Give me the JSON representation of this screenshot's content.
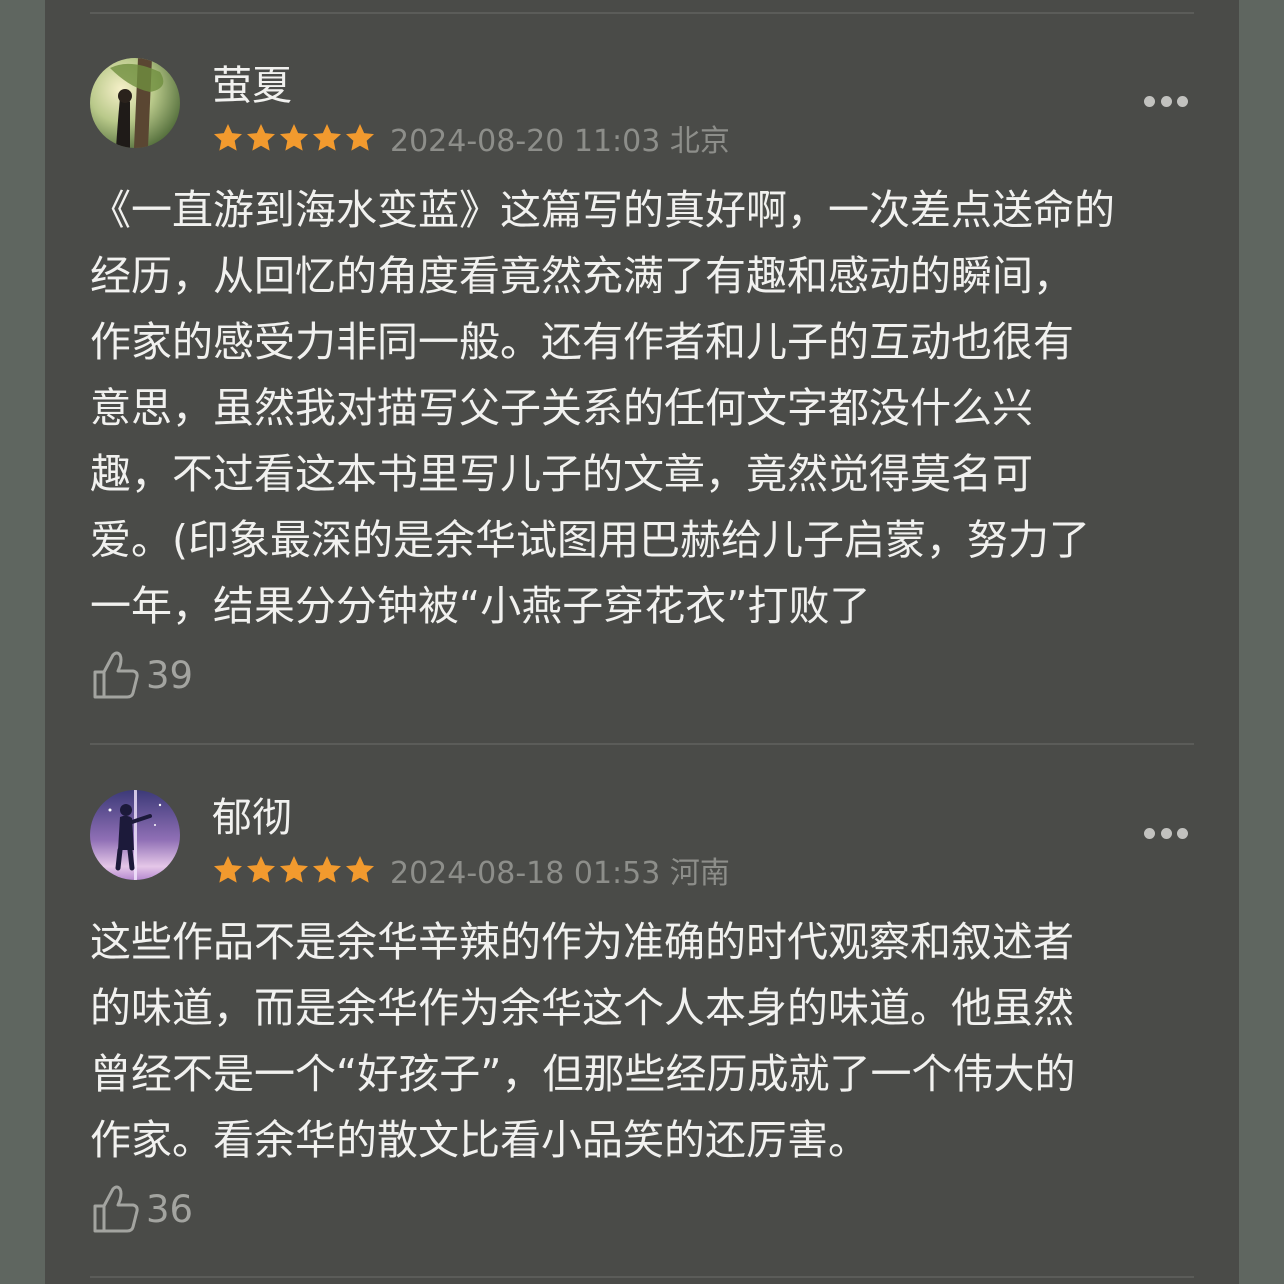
{
  "colors": {
    "background": "#5f6660",
    "panel": "#4a4b48",
    "star": "#f29a2e",
    "text": "#f1f1ef",
    "meta": "#8d8e8a"
  },
  "reviews": [
    {
      "username": "萤夏",
      "avatar_icon": "avatar-tree-portrait-icon",
      "rating": 5,
      "date_location": "2024-08-20 11:03 北京",
      "lines": [
        "《一直游到海水变蓝》这篇写的真好啊，一次差点送命的",
        "经历，从回忆的角度看竟然充满了有趣和感动的瞬间，",
        "作家的感受力非同一般。还有作者和儿子的互动也很有",
        "意思，虽然我对描写父子关系的任何文字都没什么兴",
        "趣，不过看这本书里写儿子的文章，竟然觉得莫名可",
        "爱。(印象最深的是余华试图用巴赫给儿子启蒙，努力了",
        "一年，结果分分钟被“小燕子穿花衣”打败了"
      ],
      "likes": "39"
    },
    {
      "username": "郁彻",
      "avatar_icon": "avatar-starry-figure-icon",
      "rating": 5,
      "date_location": "2024-08-18 01:53 河南",
      "lines": [
        "这些作品不是余华辛辣的作为准确的时代观察和叙述者",
        "的味道，而是余华作为余华这个人本身的味道。他虽然",
        "曾经不是一个“好孩子”，但那些经历成就了一个伟大的",
        "作家。看余华的散文比看小品笑的还厉害。"
      ],
      "likes": "36"
    }
  ]
}
